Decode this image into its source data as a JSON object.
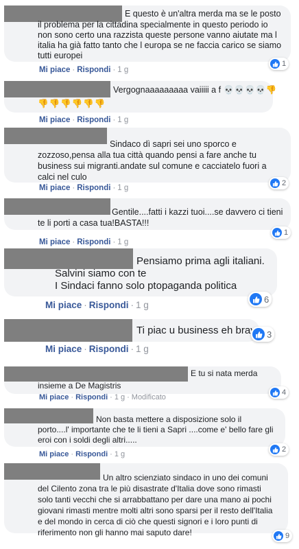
{
  "actions": {
    "like": "Mi piace",
    "reply": "Rispondi",
    "dot": "·",
    "time": "1 g",
    "edited": "Modificato"
  },
  "comments": [
    {
      "lines": [
        "E questo è un'altra merda ma se le posto",
        "il problema per la cittadina specialmente in questo periodo io",
        "non sono certo una razzista queste persone vanno aiutate ma l",
        "italia ha già fatto tanto che l europa se ne faccia carico se siamo",
        "tutti europei"
      ],
      "reactions": "1"
    },
    {
      "lines": [
        "Vergognaaaaaaaaa vaiiiii a f 💀💀💀💀👎",
        "👎👎👎👎👎👎"
      ],
      "reactions": ""
    },
    {
      "lines": [
        "Sindaco dì sapri sei uno sporco e",
        "zozzoso,pensa alla tua città quando pensi a fare anche tu",
        "business sui migranti.andate sul comune e cacciatelo fuori a",
        "calci nel culo"
      ],
      "reactions": "2"
    },
    {
      "lines": [
        "Gentile....fatti i kazzi tuoi....se davvero ci tieni",
        "te li porti a casa tua!BASTA!!!"
      ],
      "reactions": "1"
    },
    {
      "lines": [
        "Pensiamo prima agli italiani.",
        "Salvini siamo con te",
        "I Sindaci fanno solo ptopaganda politica"
      ],
      "reactions": "6"
    },
    {
      "lines": [
        "Ti piac u business eh brav"
      ],
      "reactions": "3"
    },
    {
      "lines": [
        "E tu si nata merda",
        "insieme a De Magistris"
      ],
      "reactions": "4"
    },
    {
      "lines": [
        "Non basta mettere a disposizione solo il",
        "porto....l' importante che te li tieni a Sapri ....come e' bello fare gli",
        "eroi con i soldi degli altri....."
      ],
      "reactions": "2"
    },
    {
      "lines": [
        "Un altro scienziato sindaco in uno dei comuni",
        "del Cilento zona tra le più disastrate d'Italia dove sono rimasti",
        "solo tanti vecchi che si arrabbattano per dare una mano ai pochi",
        "giovani rimasti mentre molti altri sono sparsi per il resto dell'Italia",
        "e del mondo in cerca di ciò che questi signori e i loro punti di",
        "riferimento non gli hanno mai saputo dare!"
      ],
      "reactions": "9"
    }
  ]
}
